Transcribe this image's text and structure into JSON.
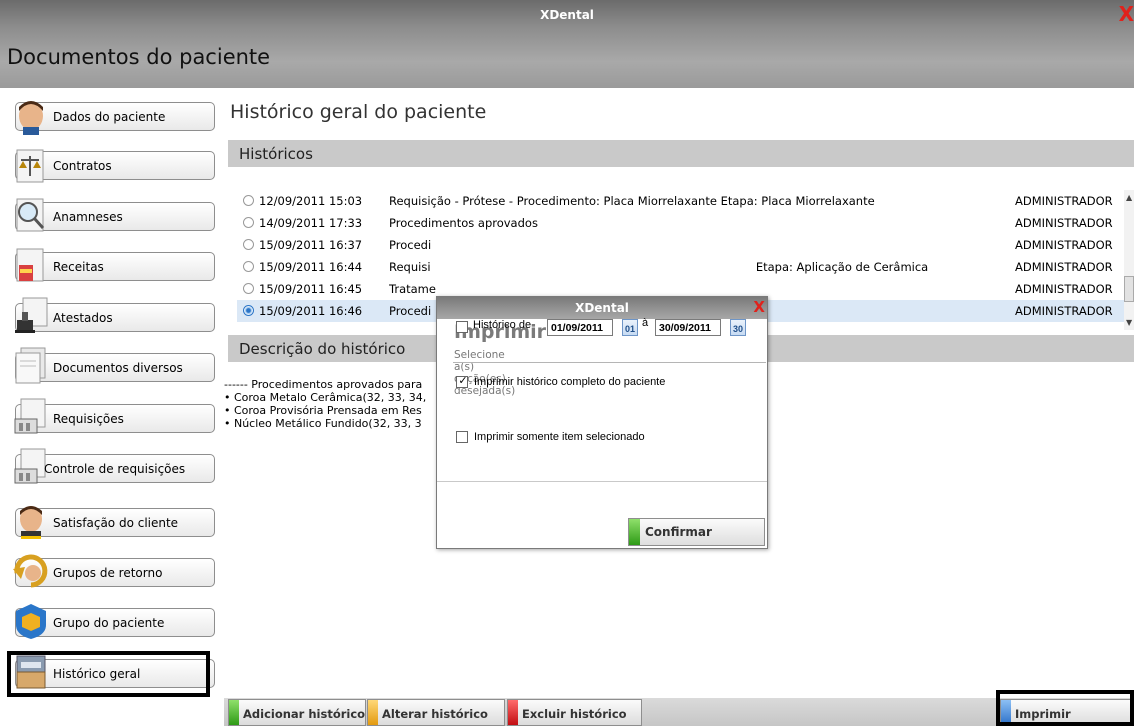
{
  "window": {
    "title": "XDental",
    "close_glyph": "X"
  },
  "page": {
    "title": "Documentos do paciente"
  },
  "sidebar": {
    "items": [
      {
        "label": "Dados do paciente",
        "icon": "patient-face-icon"
      },
      {
        "label": "Contratos",
        "icon": "scales-icon"
      },
      {
        "label": "Anamneses",
        "icon": "magnifier-icon"
      },
      {
        "label": "Receitas",
        "icon": "prescription-icon"
      },
      {
        "label": "Atestados",
        "icon": "stamp-icon"
      },
      {
        "label": "Documentos diversos",
        "icon": "documents-icon"
      },
      {
        "label": "Requisições",
        "icon": "requisition-icon"
      },
      {
        "label": "Controle de requisições",
        "icon": "requisition-control-icon"
      },
      {
        "label": "Satisfação do cliente",
        "icon": "satisfaction-icon"
      },
      {
        "label": "Grupos de retorno",
        "icon": "return-arrow-icon"
      },
      {
        "label": "Grupo do paciente",
        "icon": "shield-group-icon"
      },
      {
        "label": "Histórico geral",
        "icon": "archive-cabinet-icon"
      }
    ],
    "active": "Histórico geral"
  },
  "main": {
    "heading": "Histórico geral do paciente",
    "historicos_label": "Históricos",
    "description_label": "Descrição do histórico",
    "history": [
      {
        "datetime": "12/09/2011 15:03",
        "description": "Requisição - Prótese - Procedimento: Placa Miorrelaxante Etapa: Placa Miorrelaxante",
        "user": "ADMINISTRADOR",
        "selected": false
      },
      {
        "datetime": "14/09/2011 17:33",
        "description": "Procedimentos aprovados",
        "user": "ADMINISTRADOR",
        "selected": false
      },
      {
        "datetime": "15/09/2011 16:37",
        "description": "Procedi",
        "user": "ADMINISTRADOR",
        "selected": false
      },
      {
        "datetime": "15/09/2011 16:44",
        "description": "Requisi                                                                                         Etapa: Aplicação de Cerâmica",
        "user": "ADMINISTRADOR",
        "selected": false
      },
      {
        "datetime": "15/09/2011 16:45",
        "description": "Tratame",
        "user": "ADMINISTRADOR",
        "selected": false
      },
      {
        "datetime": "15/09/2011 16:46",
        "description": "Procedi",
        "user": "ADMINISTRADOR",
        "selected": true
      }
    ],
    "description_lines": [
      "------ Procedimentos aprovados para",
      "• Coroa Metalo Cerâmica(32, 33, 34,",
      "• Coroa Provisória Prensada em Res",
      "• Núcleo Metálico Fundido(32, 33, 3"
    ]
  },
  "modal": {
    "title": "XDental",
    "close_glyph": "X",
    "heading": "Imprimir",
    "subtitle": "Selecione a(s) opção(es) desejada(s)",
    "historico_de_label": "Histórico de",
    "date_from": "01/09/2011",
    "date_to": "30/09/2011",
    "date_sep": "à",
    "cal_from_label": "01",
    "cal_to_label": "30",
    "options": [
      {
        "label": "Imprimir histórico completo do paciente",
        "checked": true
      },
      {
        "label": "Imprimir somente item selecionado",
        "checked": false
      }
    ],
    "historico_de_checked": false,
    "confirm_label": "Confirmar"
  },
  "bottom": {
    "add_label": "Adicionar histórico",
    "edit_label": "Alterar histórico",
    "delete_label": "Excluir histórico",
    "print_label": "Imprimir"
  },
  "colors": {
    "add_stripe": "#3aa61d",
    "edit_stripe": "#f0a81c",
    "delete_stripe": "#d9181b",
    "print_stripe": "#4a8ee0",
    "close_red": "#e0221c"
  }
}
